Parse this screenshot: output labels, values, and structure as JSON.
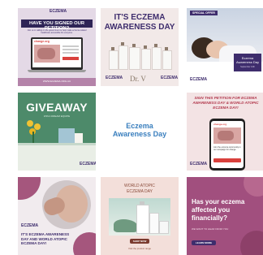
{
  "tiles": {
    "t1": {
      "banner": "HAVE YOU SIGNED OUR PETITION?",
      "subtext": "Join us in calling on the government to help make eczema-related healthcare accessible for everyone.",
      "screen_title": "change.org",
      "footer": "WWW.ECZEMA.ORG.AU"
    },
    "t2": {
      "headline_1": "IT'S ECZEMA",
      "headline_2": "AWARENESS DAY",
      "brand": "Dr. V"
    },
    "t3": {
      "tag": "SPECIAL OFFER",
      "card_title": "Eczema Awareness Day",
      "card_date": "September 14th"
    },
    "t4": {
      "headline": "GIVEAWAY",
      "subtext": "WIN A DREAM EQUIPE"
    },
    "t5": {
      "line_1": "Eczema",
      "line_2": "Awareness Day"
    },
    "t6": {
      "headline": "SIGN THIS PETITION FOR ECZEMA AWARENESS DAY & WORLD ATOPIC ECZEMA DAY!",
      "phone_title": "change.org",
      "phone_caption": "Join the eczema community in our campaign for change"
    },
    "t7": {
      "headline": "IT'S ECZEMA AWARENESS DAY AND WORLD ATOPIC ECZEMA DAY!"
    },
    "t8": {
      "headline_1": "WORLD ATOPIC",
      "headline_2": "ECZEMA DAY",
      "button": "SHOP NOW",
      "footer": "Visit the product range"
    },
    "t9": {
      "headline": "Has your eczema affected you financially?",
      "subtext": "WE WANT TO HEAR FROM YOU",
      "button": "LEARN MORE"
    },
    "logo_text": "ECZEMA",
    "logo_sub": "SUPPORT AUSTRALIA"
  }
}
